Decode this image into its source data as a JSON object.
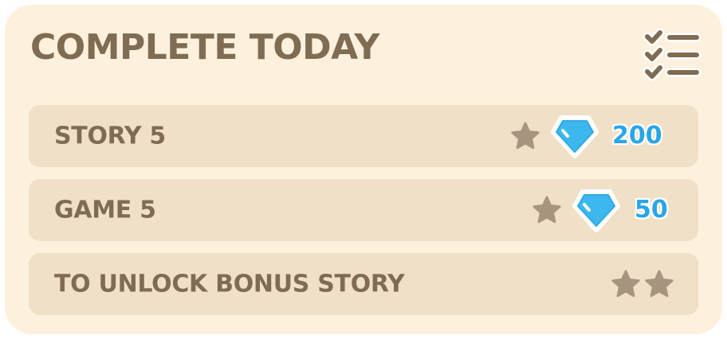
{
  "panel": {
    "title": "COMPLETE TODAY"
  },
  "tasks": [
    {
      "label": "STORY 5",
      "stars": 1,
      "reward": "200"
    },
    {
      "label": "GAME 5",
      "stars": 1,
      "reward": "50"
    },
    {
      "label": "TO UNLOCK BONUS STORY",
      "stars": 2,
      "reward": ""
    }
  ],
  "icons": {
    "header": "checklist-icon",
    "task_star": "star-icon",
    "reward": "gem-icon"
  },
  "colors": {
    "panel_bg": "#fdf0dd",
    "row_bg": "#f1e0c8",
    "text": "#7f6c53",
    "star": "#a89580",
    "gem": "#3cb8ef",
    "reward_text": "#29a5e8"
  }
}
